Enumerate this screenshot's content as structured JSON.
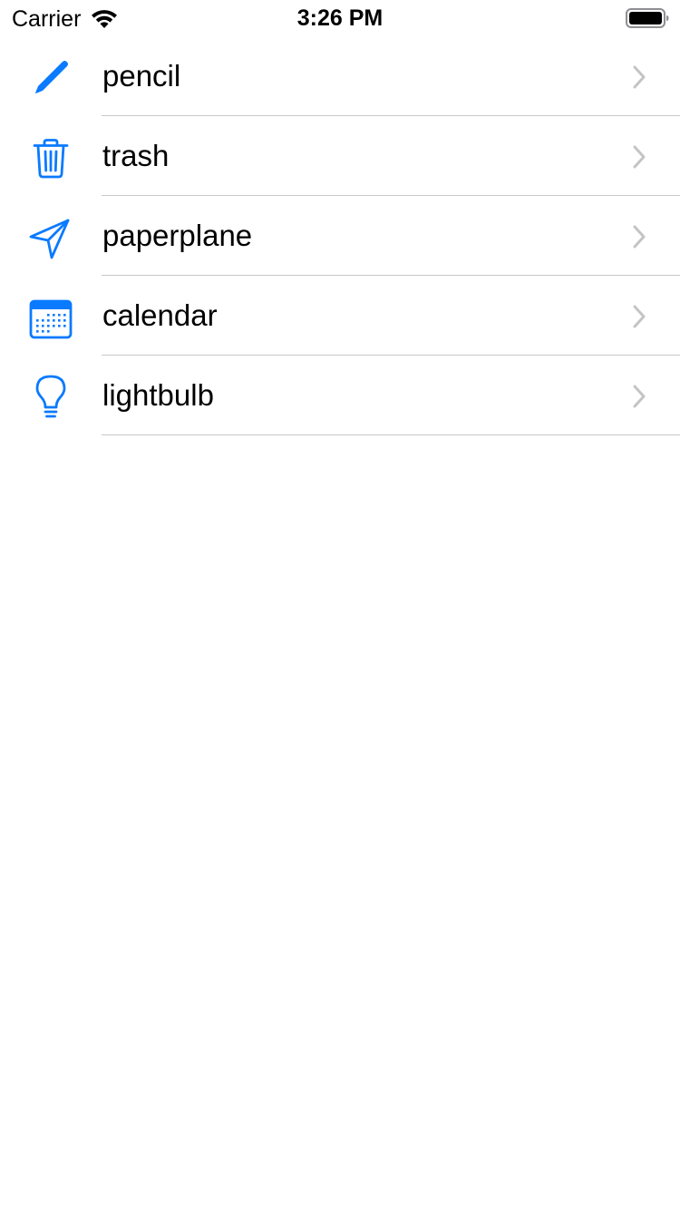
{
  "status_bar": {
    "carrier": "Carrier",
    "time": "3:26 PM",
    "wifi_icon": "wifi-icon",
    "battery_icon": "battery-full-icon"
  },
  "accent_color": "#0a7aff",
  "separator_color": "#c8c7cc",
  "chevron_color": "#c4c4c7",
  "rows": [
    {
      "label": "pencil",
      "icon": "pencil-icon"
    },
    {
      "label": "trash",
      "icon": "trash-icon"
    },
    {
      "label": "paperplane",
      "icon": "paperplane-icon"
    },
    {
      "label": "calendar",
      "icon": "calendar-icon"
    },
    {
      "label": "lightbulb",
      "icon": "lightbulb-icon"
    }
  ]
}
